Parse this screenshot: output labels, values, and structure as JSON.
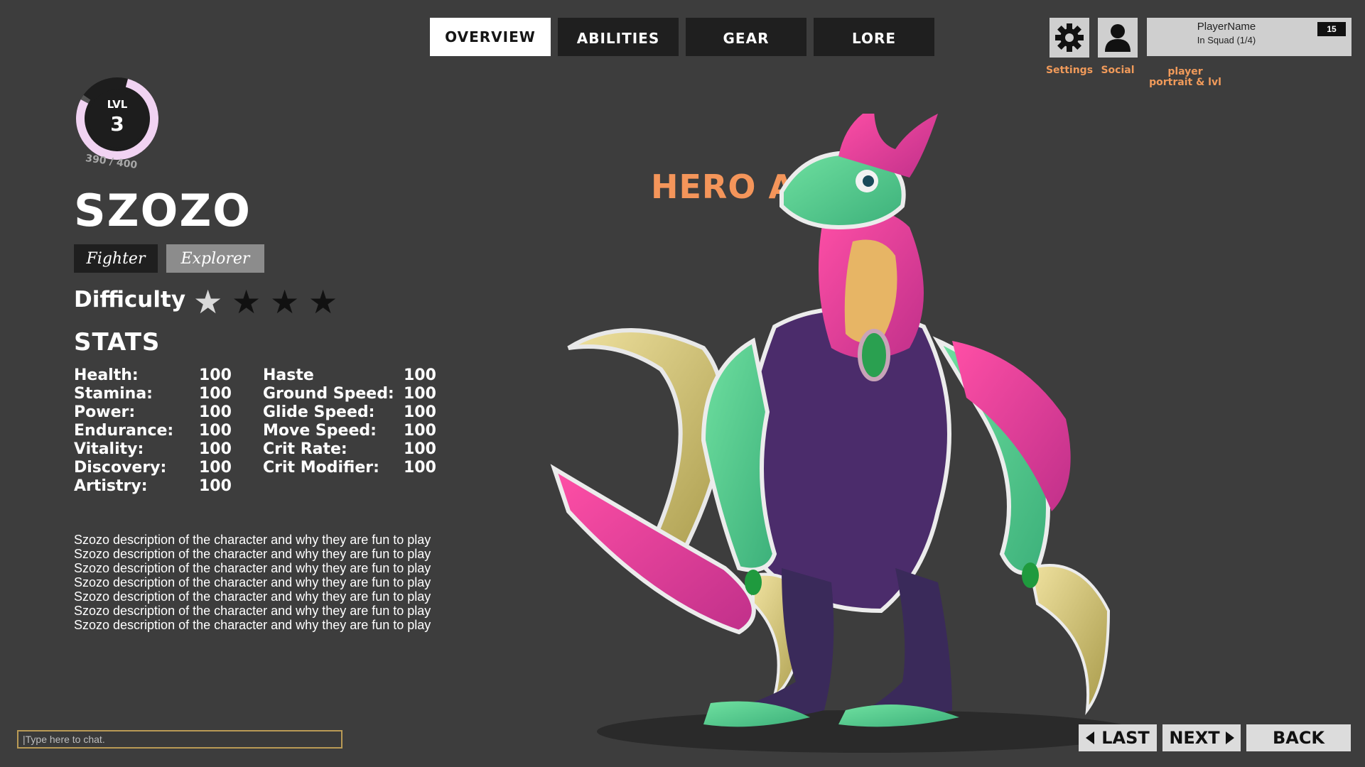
{
  "tabs": [
    "OVERVIEW",
    "ABILITIES",
    "GEAR",
    "LORE"
  ],
  "top_right": {
    "settings_label": "Settings",
    "social_label": "Social",
    "player_name": "PlayerName",
    "player_status": "In Squad (1/4)",
    "player_level": "15",
    "portrait_label_1": "player",
    "portrait_label_2": "portrait & lvl"
  },
  "level": {
    "label": "LVL",
    "value": "3",
    "xp": "390 / 400",
    "progress": 0.975
  },
  "hero": {
    "name": "SZOZO",
    "roles": [
      "Fighter",
      "Explorer"
    ]
  },
  "difficulty": {
    "label": "Difficulty",
    "filled": 1,
    "total": 4
  },
  "stats": {
    "title": "STATS",
    "left": [
      {
        "name": "Health:",
        "value": "100"
      },
      {
        "name": "Stamina:",
        "value": "100"
      },
      {
        "name": "Power:",
        "value": "100"
      },
      {
        "name": "Endurance:",
        "value": "100"
      },
      {
        "name": "Vitality:",
        "value": "100"
      },
      {
        "name": "Discovery:",
        "value": "100"
      },
      {
        "name": "Artistry:",
        "value": "100"
      }
    ],
    "right": [
      {
        "name": "Haste",
        "value": "100"
      },
      {
        "name": "Ground Speed:",
        "value": "100"
      },
      {
        "name": "Glide Speed:",
        "value": "100"
      },
      {
        "name": "Move Speed:",
        "value": "100"
      },
      {
        "name": "Crit Rate:",
        "value": "100"
      },
      {
        "name": "Crit Modifier:",
        "value": "100"
      }
    ]
  },
  "description": "Szozo description of the character and why they are fun to play Szozo description of the character and why they are fun to play Szozo description of the character and why they are fun to play Szozo description of the character and why they are fun to play Szozo description of the character and why they are fun to play Szozo description of the character and why they are fun to play Szozo description of the character and why they are fun to play",
  "hero_art_label": "HERO ART",
  "chat": {
    "placeholder": "|Type here to chat."
  },
  "nav": {
    "last": "LAST",
    "next": "NEXT",
    "back": "BACK"
  },
  "colors": {
    "accent": "#f4955a",
    "background": "#3d3d3d",
    "xp_ring": "#f1d3f2"
  }
}
